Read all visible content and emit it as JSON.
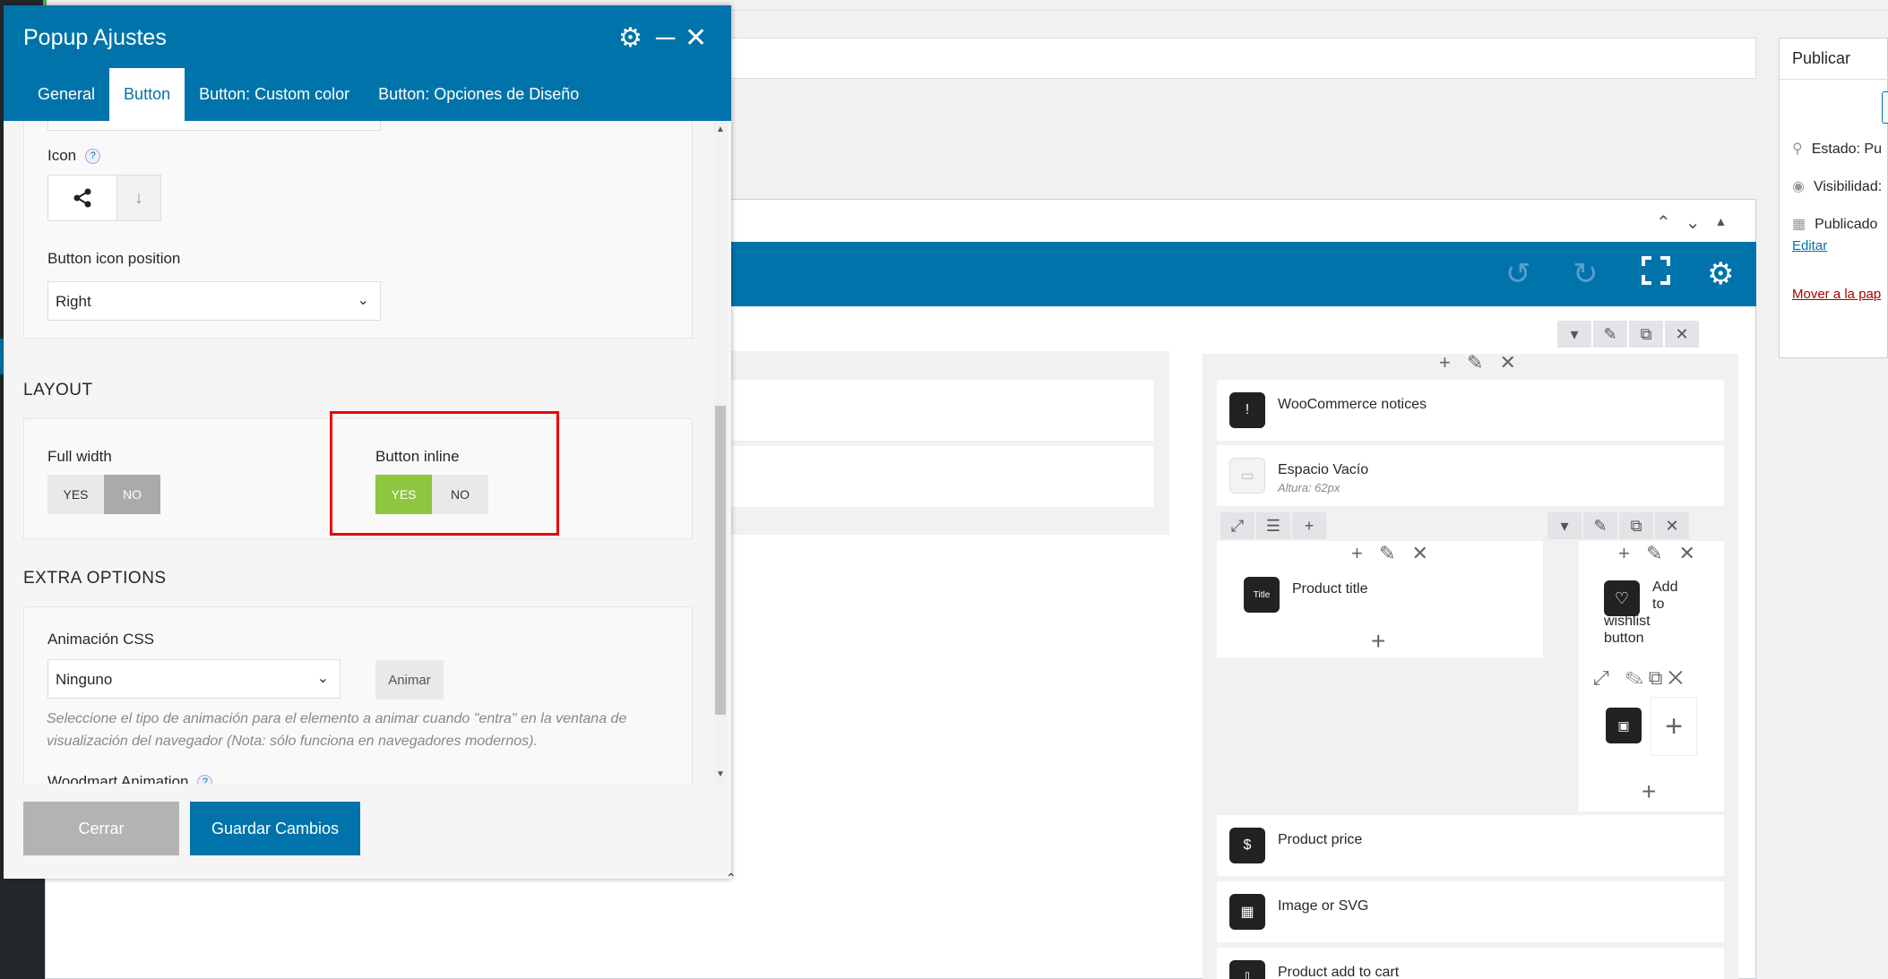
{
  "popup": {
    "title": "Popup Ajustes",
    "tabs": [
      {
        "label": "General",
        "active": false
      },
      {
        "label": "Button",
        "active": true
      },
      {
        "label": "Button: Custom color",
        "active": false
      },
      {
        "label": "Button: Opciones de Diseño",
        "active": false
      }
    ],
    "icon_field": {
      "label": "Icon",
      "help": "?"
    },
    "icon_position": {
      "label": "Button icon position",
      "value": "Right"
    },
    "layout": {
      "title": "LAYOUT",
      "full_width": {
        "label": "Full width",
        "yes": "YES",
        "no": "NO",
        "selected": "NO"
      },
      "button_inline": {
        "label": "Button inline",
        "yes": "YES",
        "no": "NO",
        "selected": "YES"
      }
    },
    "extra": {
      "title": "EXTRA OPTIONS",
      "animation_label": "Animación CSS",
      "animation_value": "Ninguno",
      "animate_button": "Animar",
      "description": "Seleccione el tipo de animación para el elemento a animar cuando \"entra\" en la ventana de visualización del navegador (Nota: sólo funciona en navegadores modernos).",
      "woodmart_label": "Woodmart Animation",
      "help": "?"
    },
    "footer": {
      "close": "Cerrar",
      "save": "Guardar Cambios"
    }
  },
  "builder": {
    "elements": {
      "notices": "WooCommerce notices",
      "spacer": "Espacio Vacío",
      "spacer_sub": "Altura: 62px",
      "title_icon": "Title",
      "product_title": "Product title",
      "wishlist": [
        "Add",
        "to",
        "wishlist",
        "button"
      ],
      "product_price": "Product price",
      "image": "Image or SVG",
      "add_to_cart": "Product add to cart"
    }
  },
  "sidebar": {
    "title": "Publicar",
    "estado": "Estado: Pu",
    "visibilidad": "Visibilidad:",
    "publicado": "Publicado",
    "editar": "Editar",
    "mover": "Mover a la pap"
  },
  "colors": {
    "accent": "#0073aa",
    "green": "#8dc63f",
    "highlight": "#e00000"
  }
}
